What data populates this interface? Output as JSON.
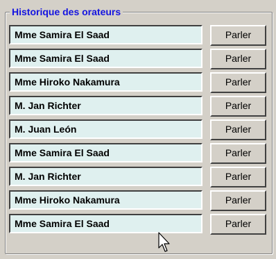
{
  "group": {
    "title": "Historique des orateurs"
  },
  "speakers": [
    {
      "name": "Mme Samira El Saad",
      "button": "Parler"
    },
    {
      "name": "Mme Samira El Saad",
      "button": "Parler"
    },
    {
      "name": "Mme Hiroko Nakamura",
      "button": "Parler"
    },
    {
      "name": "M. Jan Richter",
      "button": "Parler"
    },
    {
      "name": "M. Juan León",
      "button": "Parler"
    },
    {
      "name": "Mme Samira El Saad",
      "button": "Parler"
    },
    {
      "name": "M. Jan Richter",
      "button": "Parler"
    },
    {
      "name": "Mme Hiroko Nakamura",
      "button": "Parler"
    },
    {
      "name": "Mme Samira El Saad",
      "button": "Parler"
    }
  ],
  "cursor": {
    "icon": "arrow-cursor-icon"
  },
  "colors": {
    "legend": "#1414e0",
    "field_bg": "#dff0ef",
    "window_bg": "#d4d0c8"
  }
}
